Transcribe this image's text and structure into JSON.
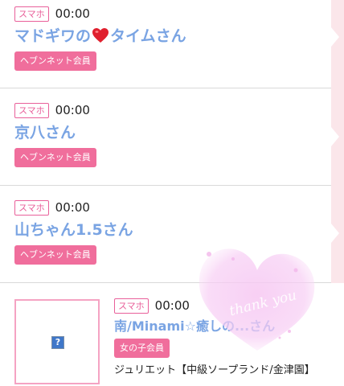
{
  "entries": [
    {
      "device": "スマホ",
      "time": "00:00",
      "name_before": "マドギワの",
      "name_after": "タイムさん",
      "member": "ヘブンネット会員"
    },
    {
      "device": "スマホ",
      "time": "00:00",
      "name": "京八さん",
      "member": "ヘブンネット会員"
    },
    {
      "device": "スマホ",
      "time": "00:00",
      "name": "山ちゃん1.5さん",
      "member": "ヘブンネット会員"
    },
    {
      "device": "スマホ",
      "time": "00:00",
      "name": "南/Minami☆癒しの...さん",
      "member": "女の子会員",
      "shop": "ジュリエット【中級ソープランド/金津園】",
      "thumb_icon": "?"
    }
  ],
  "overlay": {
    "text": "thank you"
  },
  "colors": {
    "accent_pink": "#f06e9c",
    "name_blue": "#7aa4e3",
    "badge_border": "#e9609a"
  }
}
